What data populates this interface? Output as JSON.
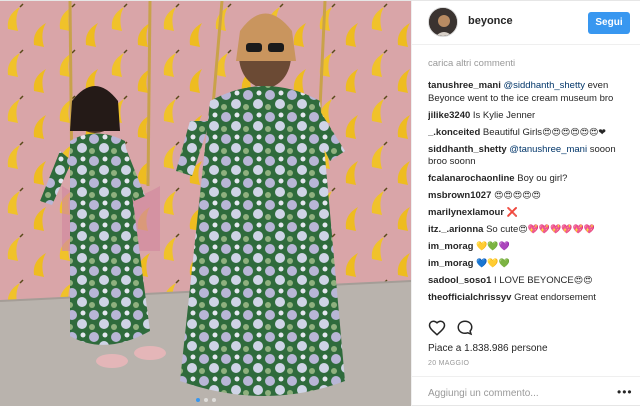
{
  "header": {
    "username": "beyonce",
    "follow_label": "Segui"
  },
  "comments_panel": {
    "load_more": "carica altri commenti",
    "comments": [
      {
        "user": "tanushree_mani",
        "parts": [
          {
            "type": "mention",
            "text": "@siddhanth_shetty"
          },
          {
            "type": "text",
            "text": " even Beyonce went to the ice cream museum bro"
          }
        ]
      },
      {
        "user": "jilike3240",
        "parts": [
          {
            "type": "text",
            "text": "Is Kylie Jenner"
          }
        ]
      },
      {
        "user": "_.konceited",
        "parts": [
          {
            "type": "text",
            "text": "Beautiful Girls"
          },
          {
            "type": "emoji",
            "text": "😍😍😍😍😍😍❤"
          }
        ]
      },
      {
        "user": "siddhanth_shetty",
        "parts": [
          {
            "type": "mention",
            "text": "@tanushree_mani"
          },
          {
            "type": "text",
            "text": " sooon broo soonn"
          }
        ]
      },
      {
        "user": "fcalanarochaonline",
        "parts": [
          {
            "type": "text",
            "text": "Boy ou girl?"
          }
        ]
      },
      {
        "user": "msbrown1027",
        "parts": [
          {
            "type": "emoji",
            "text": "😍😍😍😍😍"
          }
        ]
      },
      {
        "user": "marilynexlamour",
        "parts": [
          {
            "type": "emoji",
            "text": "❌"
          }
        ]
      },
      {
        "user": "itz._.arionna",
        "parts": [
          {
            "type": "text",
            "text": "So cute"
          },
          {
            "type": "emoji",
            "text": "😍💖💖💖💖💖💖"
          }
        ]
      },
      {
        "user": "im_morag",
        "parts": [
          {
            "type": "emoji",
            "text": "💛💚💜"
          }
        ]
      },
      {
        "user": "im_morag",
        "parts": [
          {
            "type": "emoji",
            "text": "💙💛💚"
          }
        ]
      },
      {
        "user": "sadool_soso1",
        "parts": [
          {
            "type": "text",
            "text": "I LOVE BEYONCE"
          },
          {
            "type": "emoji",
            "text": "😍😍"
          }
        ]
      },
      {
        "user": "theofficialchrissyv",
        "parts": [
          {
            "type": "text",
            "text": "Great endorsement"
          }
        ]
      }
    ]
  },
  "actions": {
    "like_icon": "heart-icon",
    "comment_icon": "speech-bubble-icon"
  },
  "likes_text": "Piace a 1.838.986 persone",
  "date_text": "20 MAGGIO",
  "add_comment": {
    "placeholder": "Aggiungi un commento...",
    "more_icon": "ellipsis-icon"
  },
  "photo": {
    "carousel_count": 3,
    "active_index": 0
  },
  "colors": {
    "follow_button": "#3897f0",
    "mention": "#003569",
    "muted_text": "#999999",
    "wall_pink": "#d9a5a8",
    "banana_yellow": "#f0c22a"
  }
}
